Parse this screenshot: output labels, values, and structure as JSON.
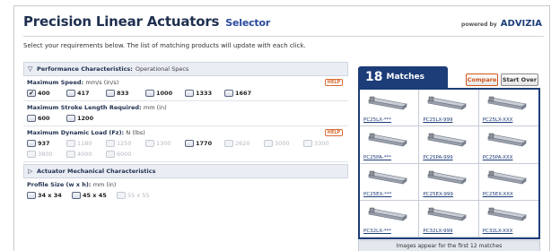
{
  "header": {
    "title": "Precision Linear Actuators",
    "selector_label": "Selector",
    "powered_by": "powered by",
    "brand": "ADVIZIA"
  },
  "intro": "Select your requirements below. The list of matching products will update with each click.",
  "performance": {
    "title": "Performance Characteristics:",
    "subtitle": "Operational Specs",
    "max_speed": {
      "label": "Maximum Speed:",
      "unit": "mm/s (in/s)",
      "help": "HELP",
      "options": [
        {
          "value": "400",
          "checked": true,
          "disabled": false
        },
        {
          "value": "417",
          "checked": false,
          "disabled": false
        },
        {
          "value": "833",
          "checked": false,
          "disabled": false
        },
        {
          "value": "1000",
          "checked": false,
          "disabled": false
        },
        {
          "value": "1333",
          "checked": false,
          "disabled": false
        },
        {
          "value": "1667",
          "checked": false,
          "disabled": false
        }
      ]
    },
    "max_stroke": {
      "label": "Maximum Stroke Length Required:",
      "unit": "mm (in)",
      "options": [
        {
          "value": "600",
          "checked": false,
          "disabled": false
        },
        {
          "value": "1200",
          "checked": false,
          "disabled": false
        }
      ]
    },
    "max_load": {
      "label": "Maximum Dynamic Load (Fz):",
      "unit": "N (lbs)",
      "help": "HELP",
      "options": [
        {
          "value": "937",
          "checked": false,
          "disabled": false
        },
        {
          "value": "1180",
          "checked": false,
          "disabled": true
        },
        {
          "value": "1250",
          "checked": false,
          "disabled": true
        },
        {
          "value": "1300",
          "checked": false,
          "disabled": true
        },
        {
          "value": "1770",
          "checked": false,
          "disabled": false
        },
        {
          "value": "2620",
          "checked": false,
          "disabled": true
        },
        {
          "value": "3000",
          "checked": false,
          "disabled": true
        },
        {
          "value": "3300",
          "checked": false,
          "disabled": true
        },
        {
          "value": "3800",
          "checked": false,
          "disabled": true
        },
        {
          "value": "4000",
          "checked": false,
          "disabled": true
        },
        {
          "value": "6000",
          "checked": false,
          "disabled": true
        }
      ]
    }
  },
  "mechanical": {
    "title": "Actuator Mechanical Characteristics",
    "profile_size": {
      "label": "Profile Size (w x h):",
      "unit": "mm (in)",
      "options": [
        {
          "value": "34 x 34",
          "checked": false,
          "disabled": false
        },
        {
          "value": "45 x 45",
          "checked": false,
          "disabled": false
        },
        {
          "value": "55 x 55",
          "checked": false,
          "disabled": true
        }
      ]
    }
  },
  "results": {
    "count": "18",
    "label": "Matches",
    "compare": "Compare",
    "start_over": "Start Over",
    "products": [
      "PC25LX-***",
      "PC25LX-999",
      "PC25LX-XXX",
      "PC25PA-***",
      "PC25PA-999",
      "PC25PA-XXX",
      "PC25EX-***",
      "PC25EX-999",
      "PC25EX-XXX",
      "PC32LX-***",
      "PC32LX-999",
      "PC32LX-XXX"
    ],
    "footnote": "Images appear for the first 12 matches"
  }
}
